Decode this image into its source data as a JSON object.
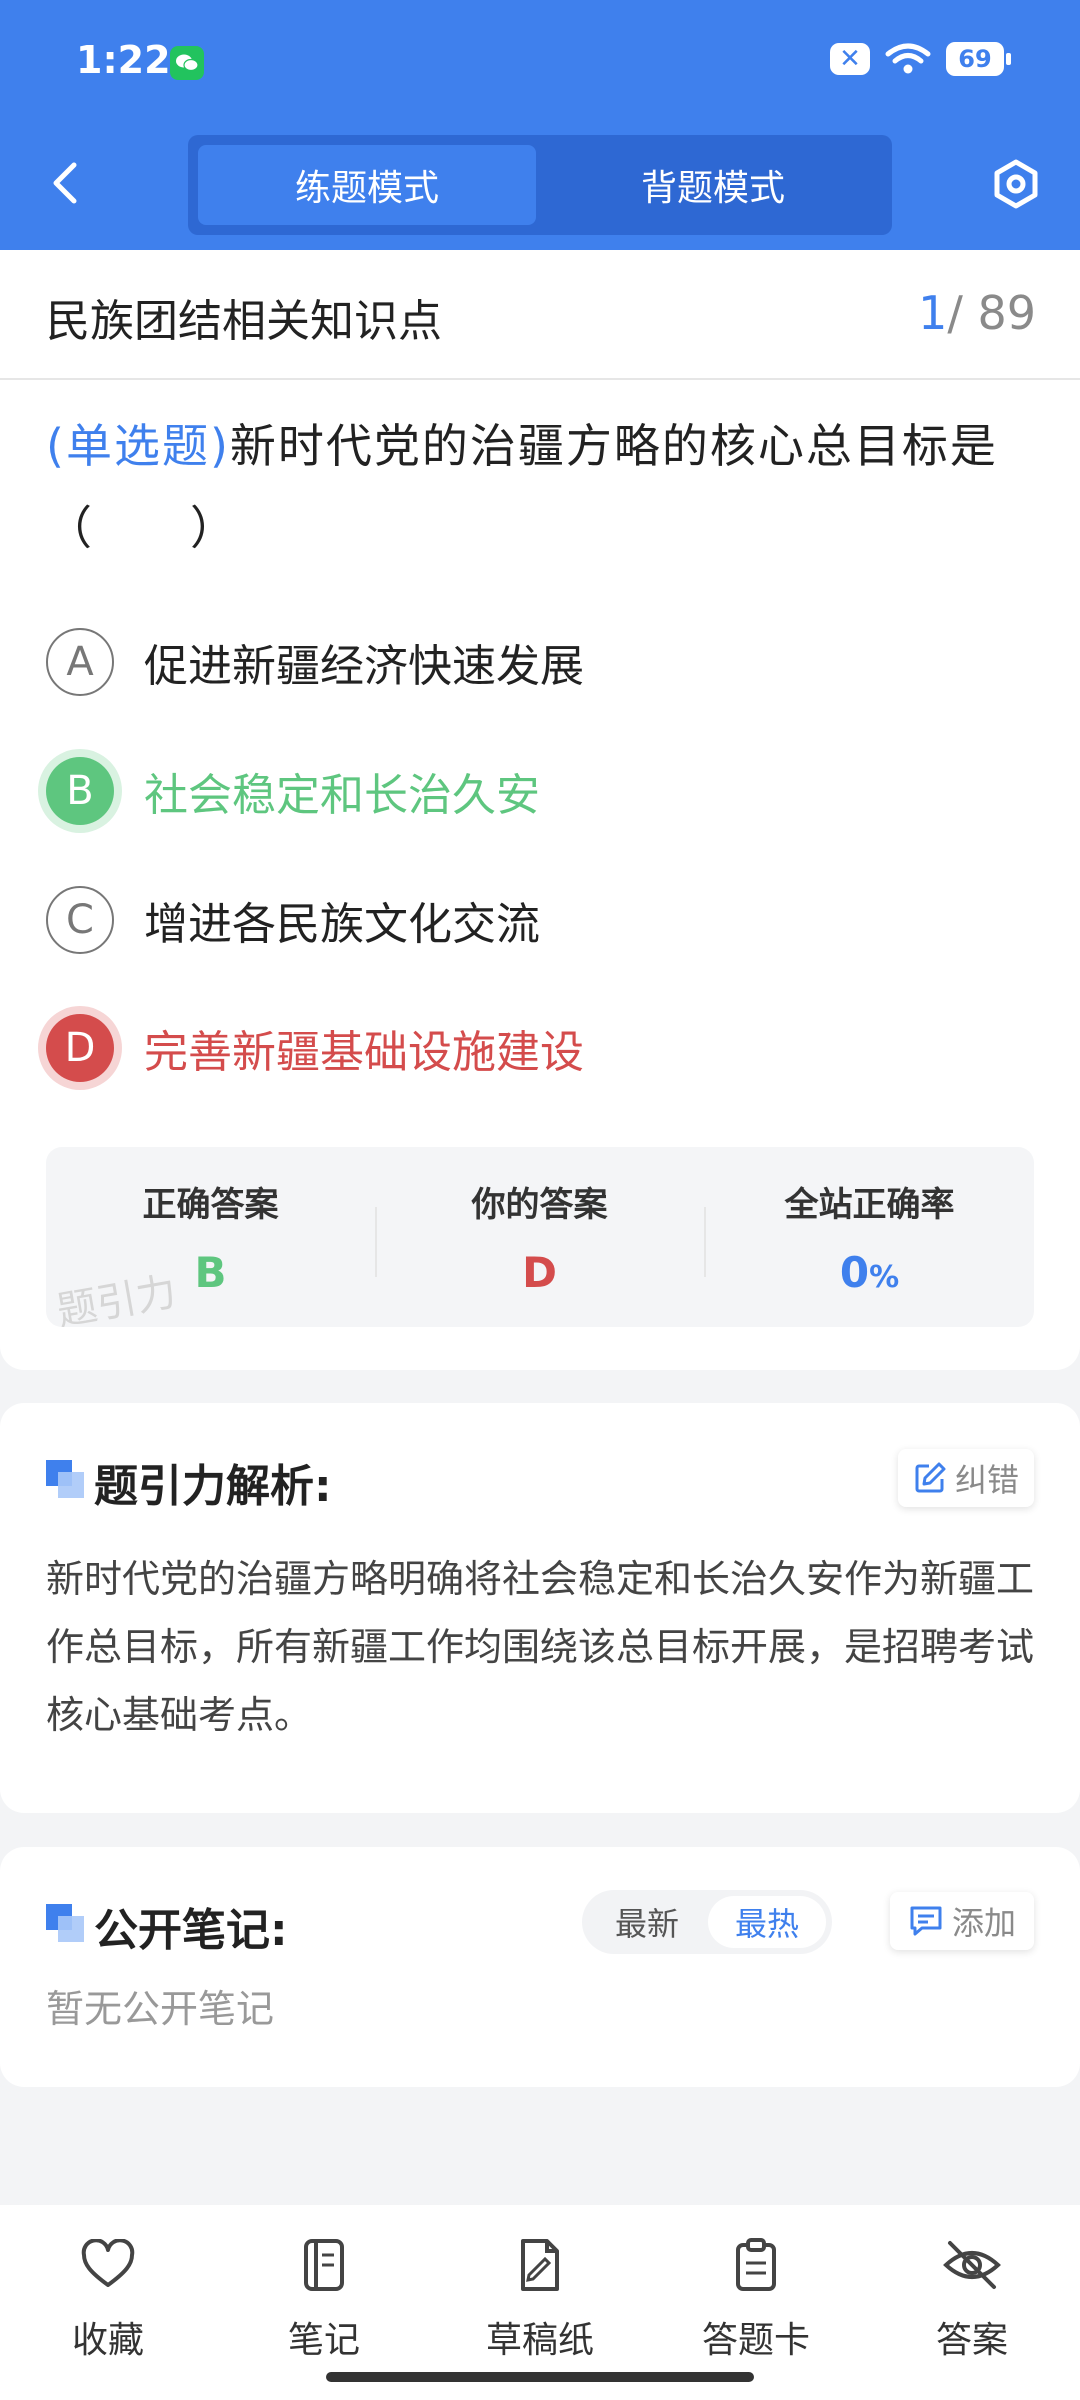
{
  "status_bar": {
    "time": "1:22",
    "battery": "69"
  },
  "header": {
    "tabs": [
      {
        "label": "练题模式",
        "active": true
      },
      {
        "label": "背题模式",
        "active": false
      }
    ]
  },
  "chapter": {
    "title": "民族团结相关知识点",
    "current": "1",
    "total": "/ 89"
  },
  "question": {
    "type_label": "(单选题)",
    "text": "新时代党的治疆方略的核心总目标是（　　）",
    "options": [
      {
        "letter": "A",
        "text": "促进新疆经济快速发展",
        "state": "normal"
      },
      {
        "letter": "B",
        "text": "社会稳定和长治久安",
        "state": "correct"
      },
      {
        "letter": "C",
        "text": "增进各民族文化交流",
        "state": "normal"
      },
      {
        "letter": "D",
        "text": "完善新疆基础设施建设",
        "state": "wrong"
      }
    ]
  },
  "result": {
    "correct_label": "正确答案",
    "correct_value": "B",
    "yours_label": "你的答案",
    "yours_value": "D",
    "rate_label": "全站正确率",
    "rate_value": "0",
    "rate_unit": "%",
    "watermark": "题引力"
  },
  "analysis": {
    "title": "题引力解析:",
    "report_label": "纠错",
    "text": "新时代党的治疆方略明确将社会稳定和长治久安作为新疆工作总目标，所有新疆工作均围绕该总目标开展，是招聘考试核心基础考点。"
  },
  "notes": {
    "title": "公开笔记:",
    "sort_options": [
      {
        "label": "最新",
        "active": false
      },
      {
        "label": "最热",
        "active": true
      }
    ],
    "add_label": "添加",
    "empty_text": "暂无公开笔记"
  },
  "bottom_nav": {
    "items": [
      {
        "label": "收藏",
        "icon": "heart-icon"
      },
      {
        "label": "笔记",
        "icon": "notebook-icon"
      },
      {
        "label": "草稿纸",
        "icon": "draft-icon"
      },
      {
        "label": "答题卡",
        "icon": "clipboard-icon"
      },
      {
        "label": "答案",
        "icon": "eye-off-icon"
      }
    ]
  },
  "colors": {
    "primary": "#3f80ed",
    "correct": "#5ec67f",
    "wrong": "#d44c4c"
  }
}
